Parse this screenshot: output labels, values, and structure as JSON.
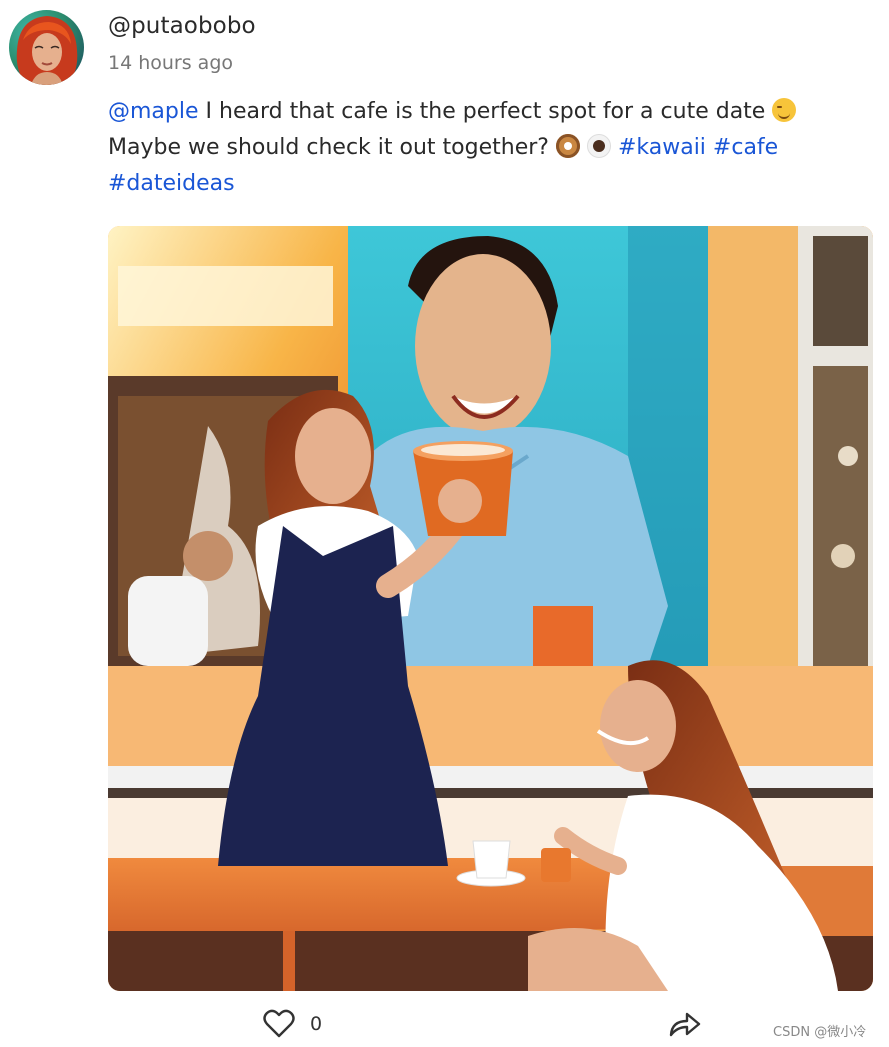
{
  "post": {
    "username": "@putaobobo",
    "timestamp": "14 hours ago",
    "mention": "@maple",
    "text_line1": " I heard that cafe is the perfect spot for a cute date ",
    "text_line2": "Maybe we should check it out together? ",
    "hashtags": [
      "#kawaii",
      "#cafe",
      "#dateideas"
    ],
    "emojis": [
      "smiling-face-emoji",
      "donut-emoji",
      "coffee-emoji"
    ]
  },
  "actions": {
    "like_count": "0",
    "like_icon": "heart-outline-icon",
    "share_icon": "share-arrow-icon"
  },
  "watermark": "CSDN @微小冷",
  "colors": {
    "link": "#1a56d6",
    "text": "#2a2a2a",
    "muted": "#777777"
  }
}
